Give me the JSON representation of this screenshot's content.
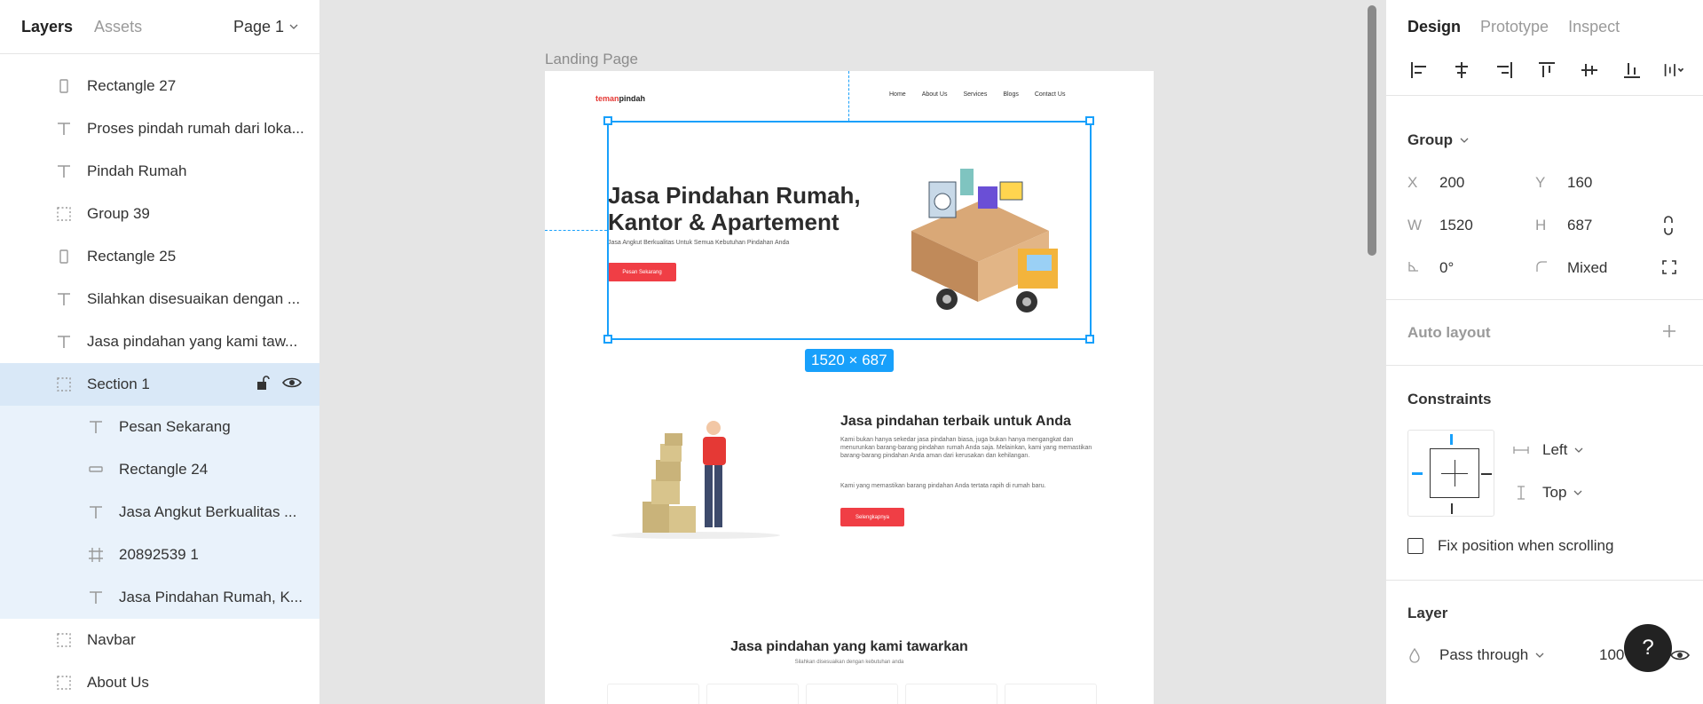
{
  "left_panel": {
    "tabs": [
      "Layers",
      "Assets"
    ],
    "page": "Page 1",
    "layers": [
      {
        "label": "Rectangle 27",
        "type": "rect-v",
        "depth": 1
      },
      {
        "label": "Proses pindah rumah dari loka...",
        "type": "text",
        "depth": 1
      },
      {
        "label": "Pindah Rumah",
        "type": "text",
        "depth": 1
      },
      {
        "label": "Group 39",
        "type": "group",
        "depth": 1
      },
      {
        "label": "Rectangle 25",
        "type": "rect-v",
        "depth": 1
      },
      {
        "label": "Silahkan disesuaikan dengan ...",
        "type": "text",
        "depth": 1
      },
      {
        "label": "Jasa pindahan yang kami taw...",
        "type": "text",
        "depth": 1
      },
      {
        "label": "Section 1",
        "type": "group",
        "depth": 1,
        "selected": true
      },
      {
        "label": "Pesan Sekarang",
        "type": "text",
        "depth": 2
      },
      {
        "label": "Rectangle 24",
        "type": "rect-h",
        "depth": 2
      },
      {
        "label": "Jasa Angkut Berkualitas ...",
        "type": "text",
        "depth": 2
      },
      {
        "label": "20892539 1",
        "type": "frame",
        "depth": 2
      },
      {
        "label": "Jasa Pindahan Rumah, K...",
        "type": "text",
        "depth": 2
      },
      {
        "label": "Navbar",
        "type": "group",
        "depth": 1
      },
      {
        "label": "About Us",
        "type": "group",
        "depth": 1
      }
    ]
  },
  "canvas": {
    "frame_label": "Landing Page",
    "logo_red": "teman",
    "logo_dark": "pindah",
    "nav": [
      "Home",
      "About Us",
      "Services",
      "Blogs",
      "Contact Us"
    ],
    "hero_title": "Jasa Pindahan Rumah, Kantor & Apartement",
    "hero_sub": "Jasa Angkut Berkualitas Untuk Semua Kebutuhan Pindahan Anda",
    "hero_button": "Pesan Sekarang",
    "s2_title": "Jasa pindahan terbaik untuk Anda",
    "s2_text": "Kami bukan hanya sekedar jasa pindahan biasa, juga bukan hanya mengangkat dan menurunkan barang-barang pindahan rumah Anda saja. Melainkan, kami yang memastikan barang-barang pindahan Anda aman dari kerusakan dan kehilangan.",
    "s2_text2": "Kami yang memastikan barang pindahan Anda tertata rapih di rumah baru.",
    "s2_button": "Selengkapnya",
    "s3_title": "Jasa pindahan yang kami tawarkan",
    "s3_sub": "Silahkan disesuaikan dengan kebutuhan anda",
    "selection_size": "1520 × 687"
  },
  "right_panel": {
    "tabs": [
      "Design",
      "Prototype",
      "Inspect"
    ],
    "group_label": "Group",
    "x_label": "X",
    "x": "200",
    "y_label": "Y",
    "y": "160",
    "w_label": "W",
    "w": "1520",
    "h_label": "H",
    "h": "687",
    "rotation": "0°",
    "radius": "Mixed",
    "auto_layout": "Auto layout",
    "constraints": "Constraints",
    "constraint_h": "Left",
    "constraint_v": "Top",
    "fix_position": "Fix position when scrolling",
    "layer": "Layer",
    "blend": "Pass through",
    "opacity": "100%"
  },
  "help": "?",
  "colors": {
    "accent": "#18a0fb",
    "brand_red": "#f03e45",
    "selected_row": "#d9e8f7",
    "child_row": "#e9f2fb"
  }
}
